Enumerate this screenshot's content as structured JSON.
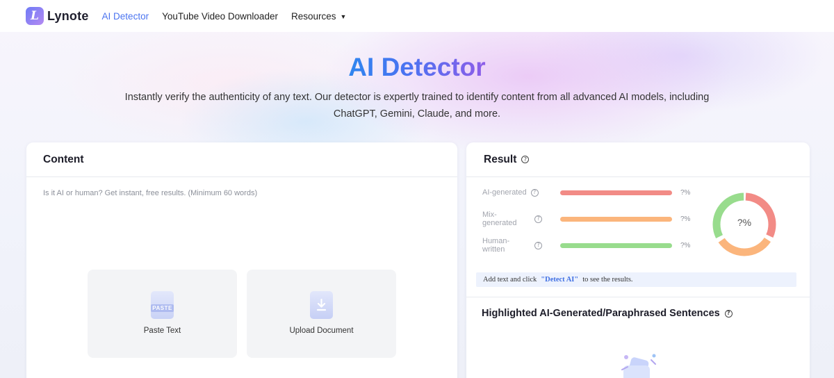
{
  "navbar": {
    "logo_text": "Lynote",
    "links": [
      {
        "label": "AI Detector",
        "active": true
      },
      {
        "label": "YouTube Video Downloader",
        "active": false
      },
      {
        "label": "Resources",
        "active": false
      }
    ],
    "accent_color": "#4b74f0"
  },
  "hero": {
    "title": "AI Detector",
    "subtitle_line1": "Instantly verify the authenticity of any text. Our detector is expertly trained to identify content from all advanced AI models, including",
    "subtitle_line2": "ChatGPT, Gemini, Claude, and more."
  },
  "content": {
    "title": "Content",
    "placeholder": "Is it AI or human? Get instant, free results. (Minimum 60 words)",
    "paste_label": "Paste Text",
    "paste_icon_text": "PASTE",
    "upload_label": "Upload Document"
  },
  "result": {
    "title": "Result",
    "rows": [
      {
        "label": "AI-generated",
        "value": "?%",
        "color": "#f28b86"
      },
      {
        "label": "Mix-generated",
        "value": "?%",
        "color": "#fbb57c"
      },
      {
        "label": "Human-written",
        "value": "?%",
        "color": "#98dc8d"
      }
    ],
    "donut_label": "?%",
    "notice_prefix": "Add text and click",
    "notice_action": "\"Detect AI\"",
    "notice_suffix": "to see the results.",
    "highlight_title": "Highlighted AI-Generated/Paraphrased Sentences"
  },
  "icons": {
    "help": "question-circle-icon",
    "caret": "caret-down-icon",
    "upload": "download-arrow-icon",
    "paste": "paste-doc-icon"
  }
}
